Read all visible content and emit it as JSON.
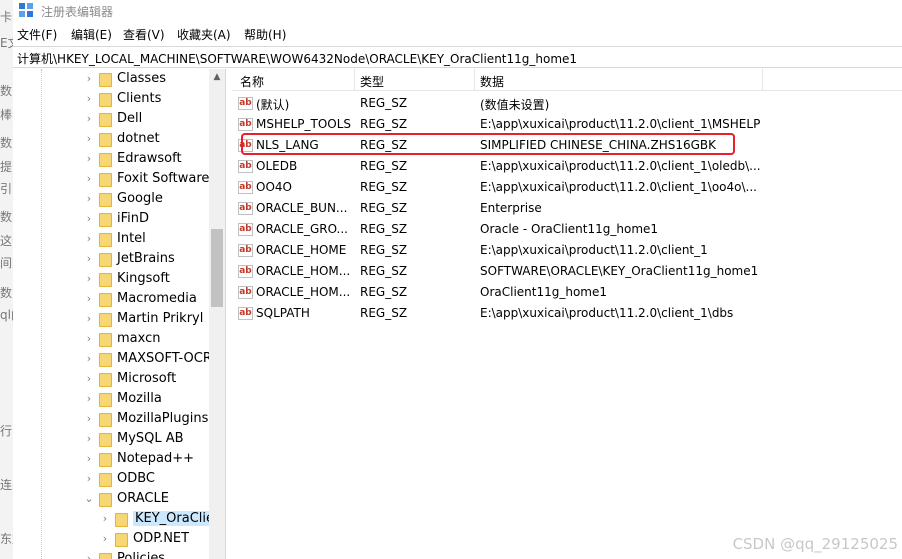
{
  "window": {
    "title": "注册表编辑器"
  },
  "menu": [
    "文件(F)",
    "编辑(E)",
    "查看(V)",
    "收藏夹(A)",
    "帮助(H)"
  ],
  "address": "计算机\\HKEY_LOCAL_MACHINE\\SOFTWARE\\WOW6432Node\\ORACLE\\KEY_OraClient11g_home1",
  "bleed_chars": [
    "卡图",
    "E文",
    "数",
    "棒",
    "数",
    "提多",
    "引的",
    "数",
    "这个",
    "间力",
    "数",
    "ql门",
    "",
    "",
    "行",
    "",
    "连务",
    "",
    "东复"
  ],
  "tree": {
    "items": [
      {
        "label": "Classes",
        "expanded": false
      },
      {
        "label": "Clients",
        "expanded": false
      },
      {
        "label": "Dell",
        "expanded": false
      },
      {
        "label": "dotnet",
        "expanded": false
      },
      {
        "label": "Edrawsoft",
        "expanded": false
      },
      {
        "label": "Foxit Software",
        "expanded": false
      },
      {
        "label": "Google",
        "expanded": false
      },
      {
        "label": "iFinD",
        "expanded": false
      },
      {
        "label": "Intel",
        "expanded": false
      },
      {
        "label": "JetBrains",
        "expanded": false
      },
      {
        "label": "Kingsoft",
        "expanded": false
      },
      {
        "label": "Macromedia",
        "expanded": false
      },
      {
        "label": "Martin Prikryl",
        "expanded": false
      },
      {
        "label": "maxcn",
        "expanded": false
      },
      {
        "label": "MAXSOFT-OCRO",
        "expanded": false
      },
      {
        "label": "Microsoft",
        "expanded": false
      },
      {
        "label": "Mozilla",
        "expanded": false
      },
      {
        "label": "MozillaPlugins",
        "expanded": false
      },
      {
        "label": "MySQL AB",
        "expanded": false
      },
      {
        "label": "Notepad++",
        "expanded": false
      },
      {
        "label": "ODBC",
        "expanded": false
      },
      {
        "label": "ORACLE",
        "expanded": true
      },
      {
        "label": "KEY_OraClien",
        "expanded": false,
        "child": true,
        "selected": true
      },
      {
        "label": "ODP.NET",
        "expanded": false,
        "child": true
      },
      {
        "label": "Policies",
        "expanded": false
      }
    ]
  },
  "list": {
    "columns": [
      "名称",
      "类型",
      "数据"
    ],
    "rows": [
      {
        "name": "(默认)",
        "type": "REG_SZ",
        "data": "(数值未设置)"
      },
      {
        "name": "MSHELP_TOOLS",
        "type": "REG_SZ",
        "data": "E:\\app\\xuxicai\\product\\11.2.0\\client_1\\MSHELP"
      },
      {
        "name": "NLS_LANG",
        "type": "REG_SZ",
        "data": "SIMPLIFIED CHINESE_CHINA.ZHS16GBK"
      },
      {
        "name": "OLEDB",
        "type": "REG_SZ",
        "data": "E:\\app\\xuxicai\\product\\11.2.0\\client_1\\oledb\\..."
      },
      {
        "name": "OO4O",
        "type": "REG_SZ",
        "data": "E:\\app\\xuxicai\\product\\11.2.0\\client_1\\oo4o\\..."
      },
      {
        "name": "ORACLE_BUN...",
        "type": "REG_SZ",
        "data": "Enterprise"
      },
      {
        "name": "ORACLE_GRO...",
        "type": "REG_SZ",
        "data": "Oracle - OraClient11g_home1"
      },
      {
        "name": "ORACLE_HOME",
        "type": "REG_SZ",
        "data": "E:\\app\\xuxicai\\product\\11.2.0\\client_1"
      },
      {
        "name": "ORACLE_HOM...",
        "type": "REG_SZ",
        "data": "SOFTWARE\\ORACLE\\KEY_OraClient11g_home1"
      },
      {
        "name": "ORACLE_HOM...",
        "type": "REG_SZ",
        "data": "OraClient11g_home1"
      },
      {
        "name": "SQLPATH",
        "type": "REG_SZ",
        "data": "E:\\app\\xuxicai\\product\\11.2.0\\client_1\\dbs"
      }
    ],
    "icon": "ab",
    "highlight_color": "#e8202a"
  },
  "watermark": "CSDN @qq_29125025"
}
